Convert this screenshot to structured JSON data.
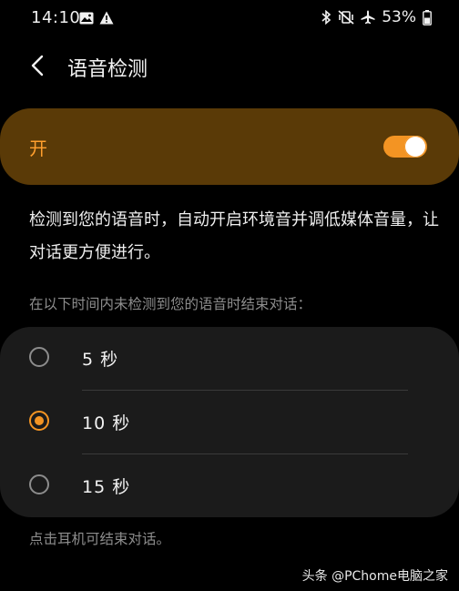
{
  "status_bar": {
    "time": "14:10",
    "battery_percent": "53%",
    "icons_left": [
      "image-icon",
      "alert-triangle-icon"
    ],
    "icons_right": [
      "bluetooth-icon",
      "vibrate-mute-icon",
      "airplane-icon",
      "battery-icon"
    ]
  },
  "header": {
    "title": "语音检测",
    "back_icon": "chevron-left-icon"
  },
  "master_switch": {
    "label": "开",
    "on": true,
    "accent_color": "#f39423",
    "background_color": "#5a3a07"
  },
  "description": "检测到您的语音时，自动开启环境音并调低媒体音量，让对话更方便进行。",
  "timeout_section": {
    "label": "在以下时间内未检测到您的语音时结束对话：",
    "options": [
      {
        "label": "5 秒",
        "selected": false
      },
      {
        "label": "10 秒",
        "selected": true
      },
      {
        "label": "15 秒",
        "selected": false
      }
    ]
  },
  "footnote": "点击耳机可结束对话。",
  "watermark": "头条 @PChome电脑之家"
}
